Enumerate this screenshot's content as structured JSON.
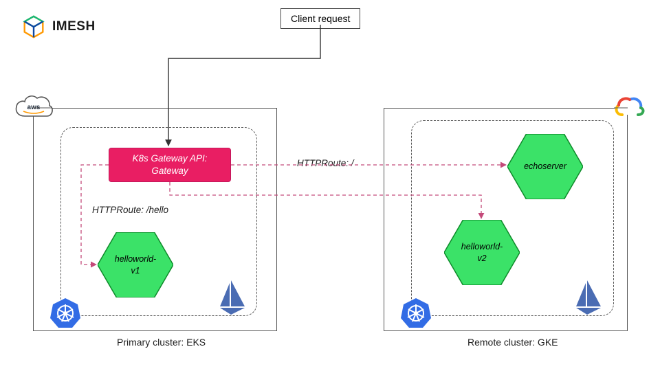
{
  "brand": {
    "name": "IMESH"
  },
  "client": {
    "label": "Client request"
  },
  "gateway": {
    "line1": "K8s Gateway API:",
    "line2": "Gateway"
  },
  "services": {
    "helloworld_v1": "helloworld-\nv1",
    "echoserver": "echoserver",
    "helloworld_v2": "helloworld-\nv2"
  },
  "routes": {
    "root": "HTTPRoute: /",
    "hello": "HTTPRoute: /hello"
  },
  "clusters": {
    "primary": "Primary cluster: EKS",
    "remote": "Remote cluster: GKE"
  },
  "colors": {
    "hexFill": "#3be268",
    "hexStroke": "#0e8a2a",
    "gateway": "#e91e63",
    "dashLine": "#c44a7a",
    "solidLine": "#333333"
  }
}
